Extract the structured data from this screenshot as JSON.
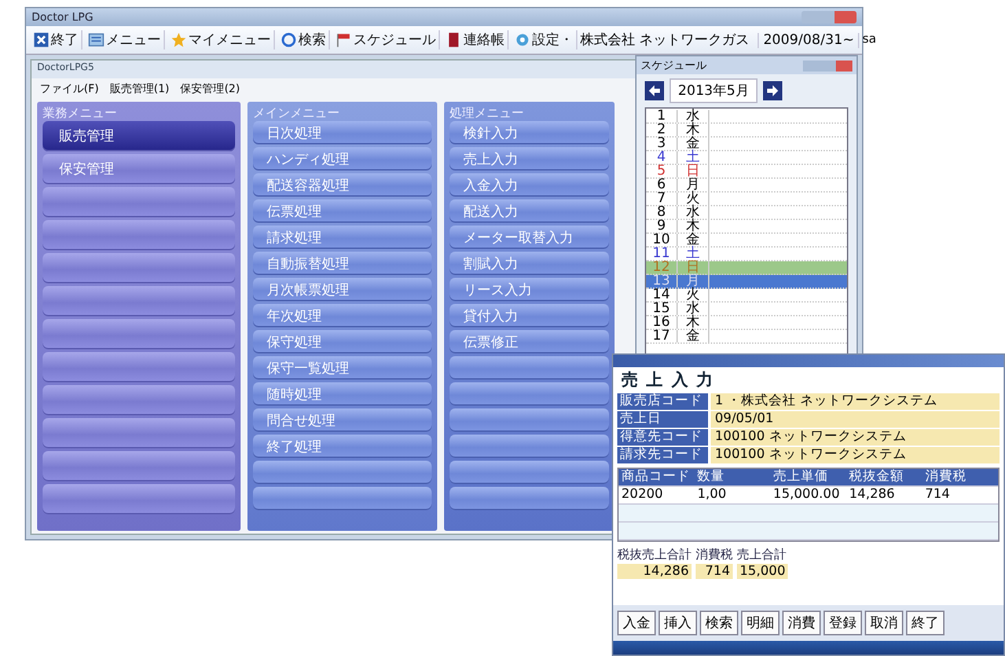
{
  "window": {
    "title": "Doctor LPG"
  },
  "toolbar": [
    {
      "label": "終了"
    },
    {
      "label": "メニュー"
    },
    {
      "label": "マイメニュー"
    },
    {
      "label": "検索"
    },
    {
      "label": "スケジュール"
    },
    {
      "label": "連絡帳"
    },
    {
      "label": "設定・"
    }
  ],
  "company": "株式会社 ネットワークガス",
  "date": "2009/08/31~",
  "user": "sa",
  "inner_window": {
    "title": "DoctorLPG5",
    "menu": [
      "ファイル(F)",
      "販売管理(1)",
      "保安管理(2)"
    ]
  },
  "panels": [
    {
      "title": "業務メニュー",
      "items": [
        {
          "label": "販売管理",
          "selected": true
        },
        {
          "label": "保安管理",
          "selected": false
        }
      ]
    },
    {
      "title": "メインメニュー",
      "items": [
        {
          "label": "日次処理"
        },
        {
          "label": "ハンディ処理"
        },
        {
          "label": "配送容器処理"
        },
        {
          "label": "伝票処理"
        },
        {
          "label": "請求処理"
        },
        {
          "label": "自動振替処理"
        },
        {
          "label": "月次帳票処理"
        },
        {
          "label": "年次処理"
        },
        {
          "label": "保守処理"
        },
        {
          "label": "保守一覧処理"
        },
        {
          "label": "随時処理"
        },
        {
          "label": "問合せ処理"
        },
        {
          "label": "終了処理"
        }
      ]
    },
    {
      "title": "処理メニュー",
      "items": [
        {
          "label": "検針入力"
        },
        {
          "label": "売上入力"
        },
        {
          "label": "入金入力"
        },
        {
          "label": "配送入力"
        },
        {
          "label": "メーター取替入力"
        },
        {
          "label": "割賦入力"
        },
        {
          "label": "リース入力"
        },
        {
          "label": "貸付入力"
        },
        {
          "label": "伝票修正"
        }
      ]
    }
  ],
  "schedule": {
    "title": "スケジュール",
    "month": "2013年5月",
    "days": [
      {
        "day": "1",
        "weekday": "水",
        "kind": "weekday",
        "highlighted": false,
        "selected": false
      },
      {
        "day": "2",
        "weekday": "木",
        "kind": "weekday",
        "highlighted": false,
        "selected": false
      },
      {
        "day": "3",
        "weekday": "金",
        "kind": "weekday",
        "highlighted": false,
        "selected": false
      },
      {
        "day": "4",
        "weekday": "土",
        "kind": "saturday",
        "highlighted": false,
        "selected": false
      },
      {
        "day": "5",
        "weekday": "日",
        "kind": "sunday",
        "highlighted": false,
        "selected": false
      },
      {
        "day": "6",
        "weekday": "月",
        "kind": "weekday",
        "highlighted": false,
        "selected": false
      },
      {
        "day": "7",
        "weekday": "火",
        "kind": "weekday",
        "highlighted": false,
        "selected": false
      },
      {
        "day": "8",
        "weekday": "水",
        "kind": "weekday",
        "highlighted": false,
        "selected": false
      },
      {
        "day": "9",
        "weekday": "木",
        "kind": "weekday",
        "highlighted": false,
        "selected": false
      },
      {
        "day": "10",
        "weekday": "金",
        "kind": "weekday",
        "highlighted": false,
        "selected": false
      },
      {
        "day": "11",
        "weekday": "土",
        "kind": "saturday",
        "highlighted": false,
        "selected": false
      },
      {
        "day": "12",
        "weekday": "日",
        "kind": "sunday",
        "highlighted": true,
        "selected": false
      },
      {
        "day": "13",
        "weekday": "月",
        "kind": "weekday",
        "highlighted": false,
        "selected": true
      },
      {
        "day": "14",
        "weekday": "火",
        "kind": "weekday",
        "highlighted": false,
        "selected": false
      },
      {
        "day": "15",
        "weekday": "水",
        "kind": "weekday",
        "highlighted": false,
        "selected": false
      },
      {
        "day": "16",
        "weekday": "木",
        "kind": "weekday",
        "highlighted": false,
        "selected": false
      },
      {
        "day": "17",
        "weekday": "金",
        "kind": "weekday",
        "highlighted": false,
        "selected": false
      }
    ]
  },
  "sales_window": {
    "heading": "売 上 入 力",
    "fields": [
      {
        "label": "販売店コード",
        "value": "1 ・株式会社 ネットワークシステム"
      },
      {
        "label": "売上日",
        "value": "09/05/01"
      },
      {
        "label": "得意先コード",
        "value": "100100 ネットワークシステム"
      },
      {
        "label": "請求先コード",
        "value": "100100 ネットワークシステム"
      }
    ],
    "grid": {
      "columns": [
        "商品コード",
        "数量",
        "売上単価",
        "税抜金額",
        "消費税"
      ],
      "rows": [
        [
          "20200",
          "1,00",
          "15,000.00",
          "14,286",
          "714"
        ]
      ]
    },
    "totals": [
      {
        "label": "税抜売上合計",
        "value": "14,286"
      },
      {
        "label": "消費税",
        "value": "714"
      },
      {
        "label": "売上合計",
        "value": "15,000"
      }
    ],
    "buttons": [
      "入金",
      "挿入",
      "検索",
      "明細",
      "消費",
      "登録",
      "取消",
      "終了"
    ]
  }
}
